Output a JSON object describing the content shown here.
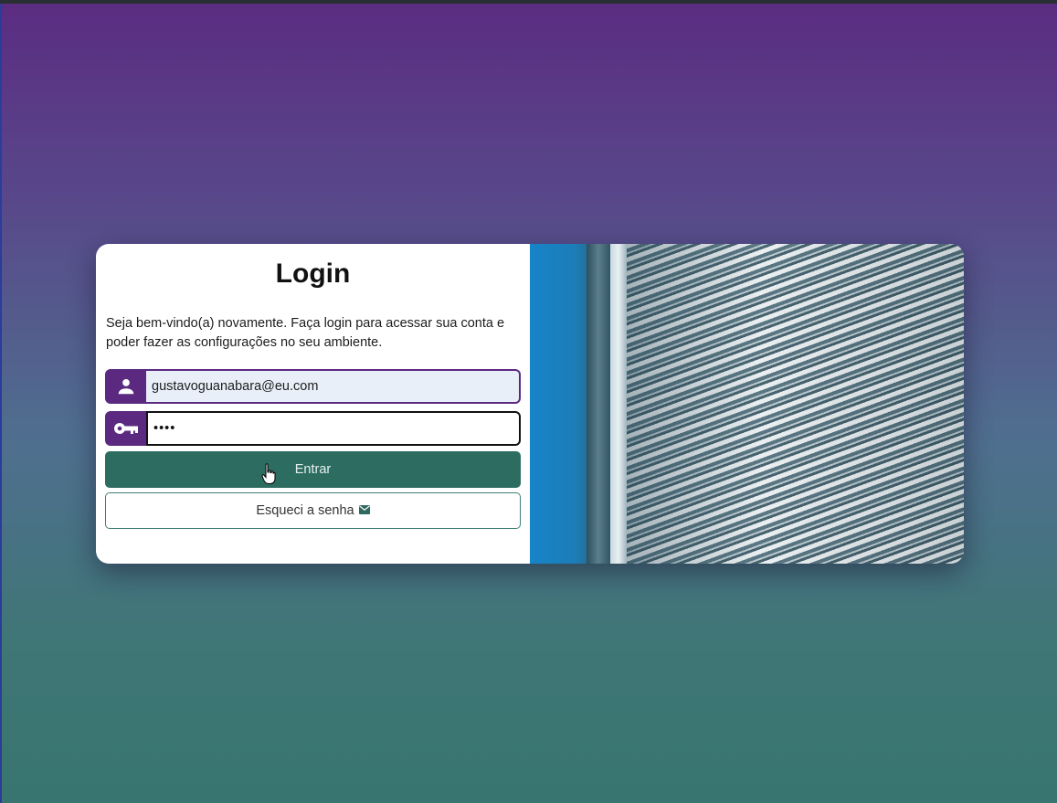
{
  "login": {
    "title": "Login",
    "description": "Seja bem-vindo(a) novamente. Faça login para acessar sua conta e poder fazer as configurações no seu ambiente.",
    "email_value": "gustavoguanabara@eu.com",
    "password_value": "1234",
    "submit_label": "Entrar",
    "forgot_label": "Esqueci a senha"
  },
  "icons": {
    "email_field": "user-icon",
    "password_field": "key-icon",
    "forgot_button": "envelope-icon"
  },
  "colors": {
    "accent_purple": "#5b2a80",
    "button_green": "#2d6c61",
    "background_top": "#5b2c82",
    "background_bottom": "#387570"
  }
}
